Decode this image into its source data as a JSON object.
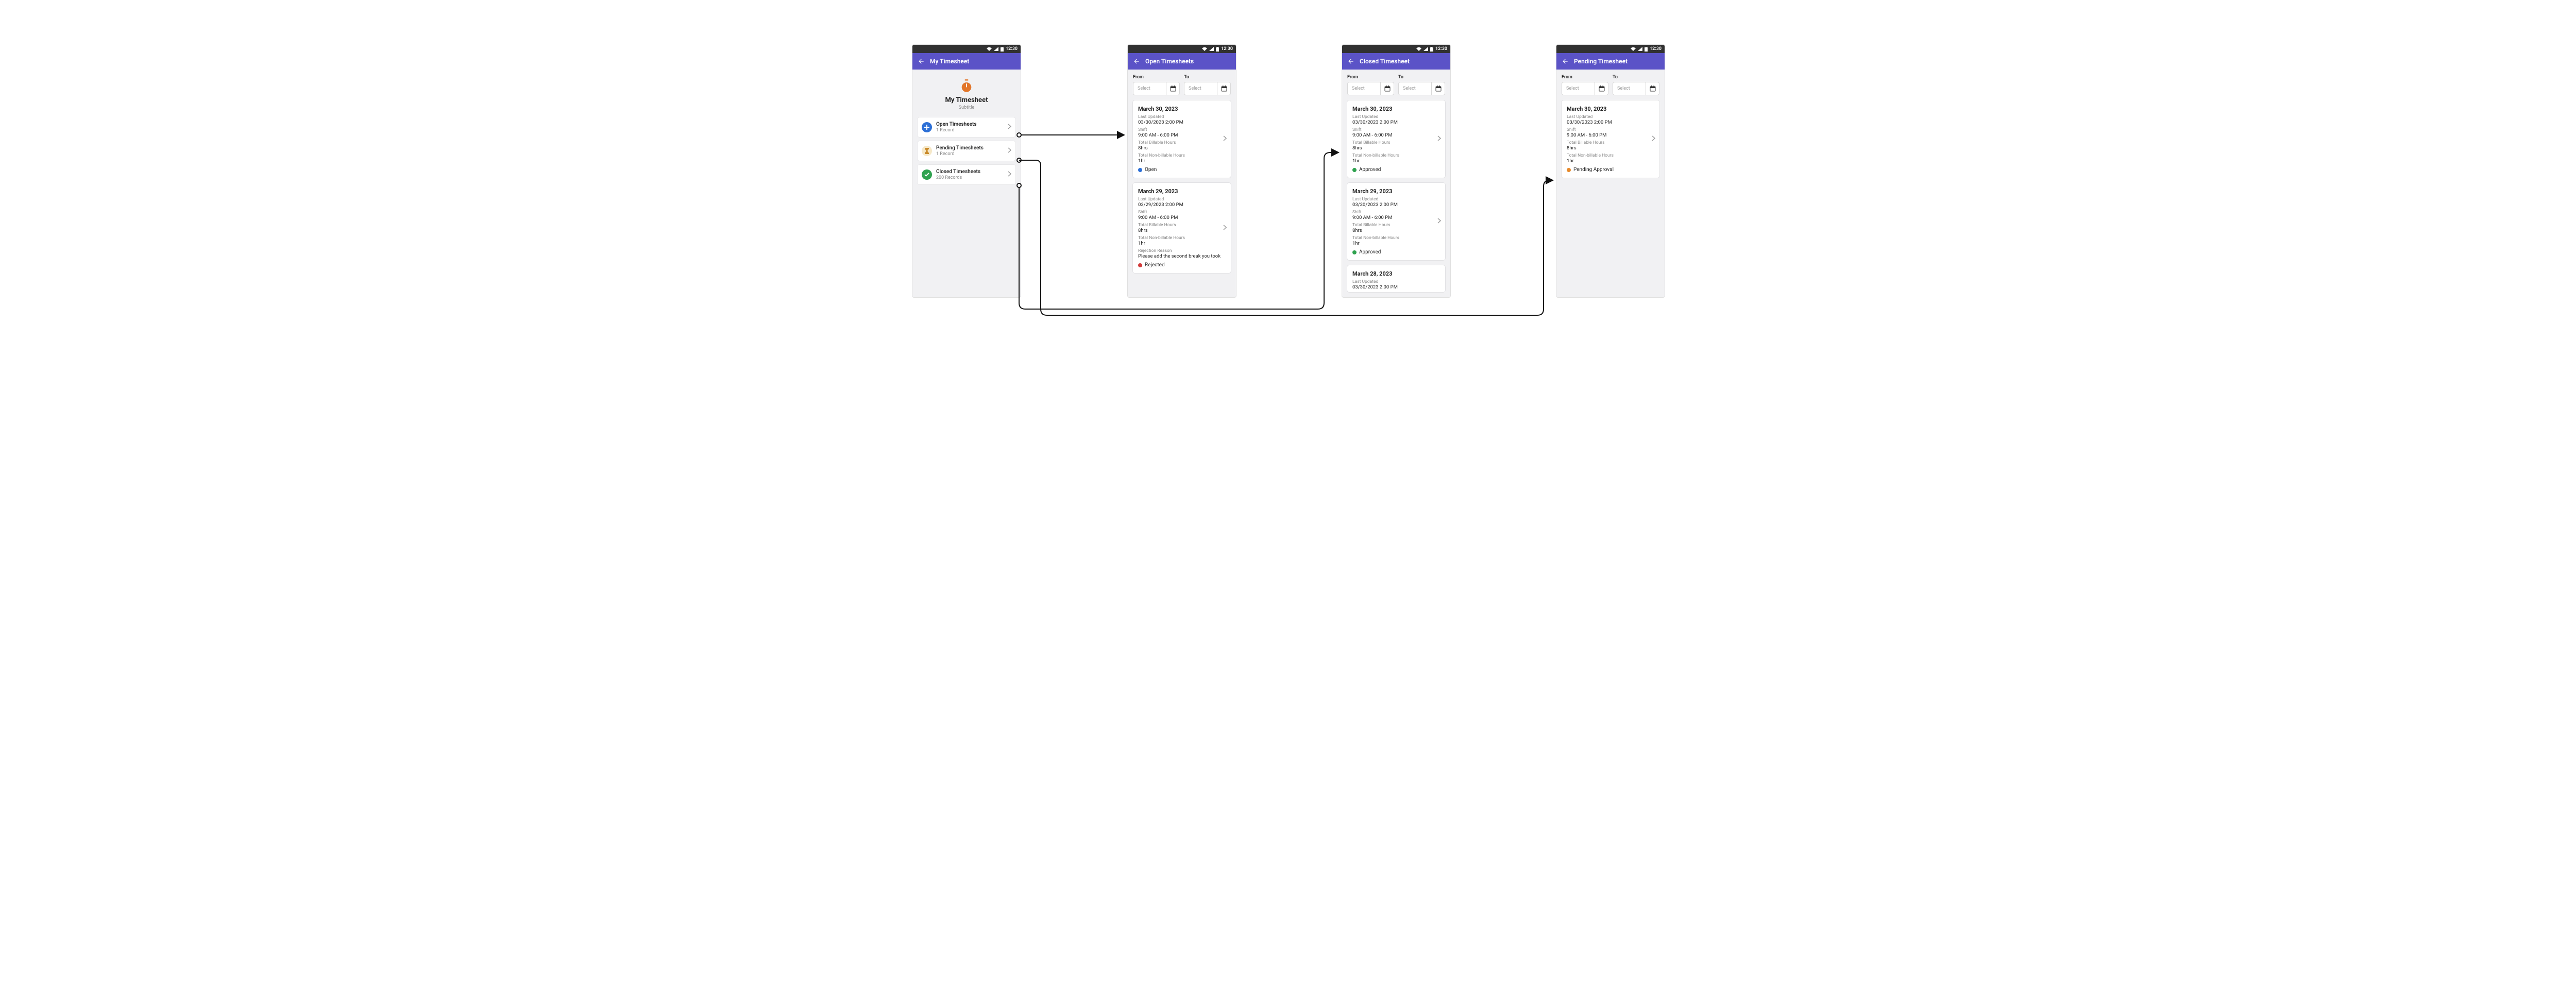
{
  "status_time": "12:30",
  "colors": {
    "brand": "#5b53c7",
    "open": "#2c6fd6",
    "pending": "#e78a2b",
    "approved": "#2fa24f",
    "rejected": "#d23b3b"
  },
  "screens": {
    "home": {
      "title": "My Timesheet",
      "hero_title": "My Timesheet",
      "hero_subtitle": "Subtitle",
      "items": [
        {
          "title": "Open Timesheets",
          "sub": "1 Record",
          "icon": "plus",
          "icon_bg": "#2c6fd6"
        },
        {
          "title": "Pending Timesheets",
          "sub": "1 Record",
          "icon": "hourglass",
          "icon_bg": "#f6e8c8",
          "icon_fg": "#c98a2a"
        },
        {
          "title": "Closed Timesheets",
          "sub": "200 Records",
          "icon": "check",
          "icon_bg": "#2fa24f"
        }
      ]
    },
    "open": {
      "title": "Open Timesheets",
      "from_label": "From",
      "to_label": "To",
      "select_placeholder": "Select",
      "cards": [
        {
          "date": "March 30, 2023",
          "last_updated_label": "Last Updated",
          "last_updated": "03/30/2023 2:00 PM",
          "shift_label": "Shift",
          "shift": "9:00 AM - 6:00 PM",
          "billable_label": "Total Billable Hours",
          "billable": "8hrs",
          "nonbillable_label": "Total Non-billable Hours",
          "nonbillable": "1hr",
          "status_label": "Open",
          "status_color": "#2c6fd6"
        },
        {
          "date": "March 29, 2023",
          "last_updated_label": "Last Updated",
          "last_updated": "03/29/2023 2:00 PM",
          "shift_label": "Shift",
          "shift": "9:00 AM - 6:00 PM",
          "billable_label": "Total Billable Hours",
          "billable": "8hrs",
          "nonbillable_label": "Total Non-billable Hours",
          "nonbillable": "1hr",
          "rejection_label": "Rejection Reason",
          "rejection": "Please add the second break you took",
          "status_label": "Rejected",
          "status_color": "#d23b3b"
        }
      ]
    },
    "closed": {
      "title": "Closed Timesheet",
      "from_label": "From",
      "to_label": "To",
      "select_placeholder": "Select",
      "cards": [
        {
          "date": "March 30, 2023",
          "last_updated_label": "Last Updated",
          "last_updated": "03/30/2023 2:00 PM",
          "shift_label": "Shift",
          "shift": "9:00 AM - 6:00 PM",
          "billable_label": "Total Billable Hours",
          "billable": "8hrs",
          "nonbillable_label": "Total Non-billable Hours",
          "nonbillable": "1hr",
          "status_label": "Approved",
          "status_color": "#2fa24f"
        },
        {
          "date": "March 29, 2023",
          "last_updated_label": "Last Updated",
          "last_updated": "03/30/2023 2:00 PM",
          "shift_label": "Shift",
          "shift": "9:00 AM - 6:00 PM",
          "billable_label": "Total Billable Hours",
          "billable": "8hrs",
          "nonbillable_label": "Total Non-billable Hours",
          "nonbillable": "1hr",
          "status_label": "Approved",
          "status_color": "#2fa24f"
        },
        {
          "date": "March 28, 2023",
          "last_updated_label": "Last Updated",
          "last_updated": "03/30/2023 2:00 PM"
        }
      ]
    },
    "pending": {
      "title": "Pending Timesheet",
      "from_label": "From",
      "to_label": "To",
      "select_placeholder": "Select",
      "cards": [
        {
          "date": "March 30, 2023",
          "last_updated_label": "Last Updated",
          "last_updated": "03/30/2023 2:00 PM",
          "shift_label": "Shift",
          "shift": "9:00 AM - 6:00 PM",
          "billable_label": "Total Billable Hours",
          "billable": "8hrs",
          "nonbillable_label": "Total Non-billable Hours",
          "nonbillable": "1hr",
          "status_label": "Pending Approval",
          "status_color": "#e78a2b"
        }
      ]
    }
  }
}
